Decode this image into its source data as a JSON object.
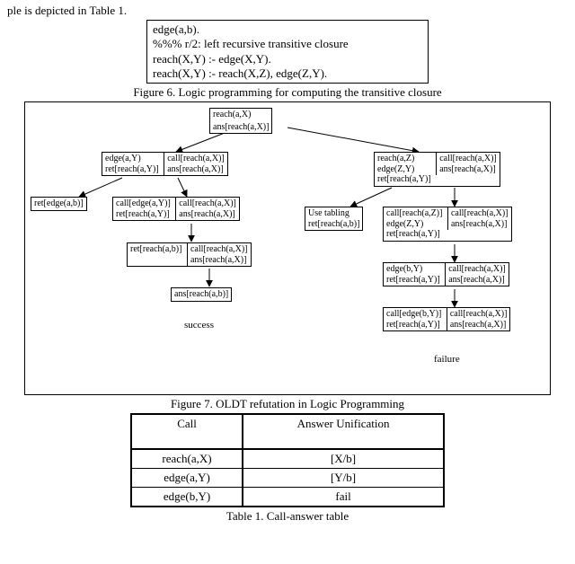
{
  "fragment_top": "ple is depicted in Table 1.",
  "code": {
    "l1": "edge(a,b).",
    "l2": "%%%  r/2: left recursive transitive closure",
    "l3": "reach(X,Y) :- edge(X,Y).",
    "l4": "reach(X,Y) :- reach(X,Z), edge(Z,Y)."
  },
  "captions": {
    "fig6": "Figure 6. Logic programming for computing the transitive closure",
    "fig7": "Figure 7. OLDT refutation in Logic Programming",
    "tab1": "Table 1. Call-answer table"
  },
  "diagram": {
    "root": {
      "left": "reach(a,X)",
      "right": "ans[reach(a,X)]"
    },
    "L1": {
      "left": "edge(a,Y)\nret[reach(a,Y)]",
      "right": "call[reach(a,X)]\nans[reach(a,X)]"
    },
    "L2a": {
      "single": "ret[edge(a,b)]"
    },
    "L2b": {
      "left": "call[edge(a,Y)]\nret[reach(a,Y)]",
      "right": "call[reach(a,X)]\nans[reach(a,X)]"
    },
    "L3": {
      "left": "ret[reach(a,b)]",
      "right": "call[reach(a,X)]\nans[reach(a,X)]"
    },
    "L4": {
      "single": "ans[reach(a,b)]"
    },
    "R1": {
      "left": "reach(a,Z)\nedge(Z,Y)\nret[reach(a,Y)]",
      "right": "call[reach(a,X)]\nans[reach(a,X)]"
    },
    "R2a": {
      "single": "Use tabling\nret[reach(a,b)]"
    },
    "R2b": {
      "left": "call[reach(a,Z)]\nedge(Z,Y)\nret[reach(a,Y)]",
      "right": "call[reach(a,X)]\nans[reach(a,X)]"
    },
    "R3": {
      "left": "edge(b,Y)\nret[reach(a,Y)]",
      "right": "call[reach(a,X)]\nans[reach(a,X)]"
    },
    "R4": {
      "left": "call[edge(b,Y)]\nret[reach(a,Y)]",
      "right": "call[reach(a,X)]\nans[reach(a,X)]"
    },
    "labels": {
      "success": "success",
      "failure": "failure"
    }
  },
  "table": {
    "h1": "Call",
    "h2": "Answer Unification",
    "rows": [
      {
        "c": "reach(a,X)",
        "a": "[X/b]"
      },
      {
        "c": "edge(a,Y)",
        "a": "[Y/b]"
      },
      {
        "c": "edge(b,Y)",
        "a": "fail"
      }
    ]
  }
}
